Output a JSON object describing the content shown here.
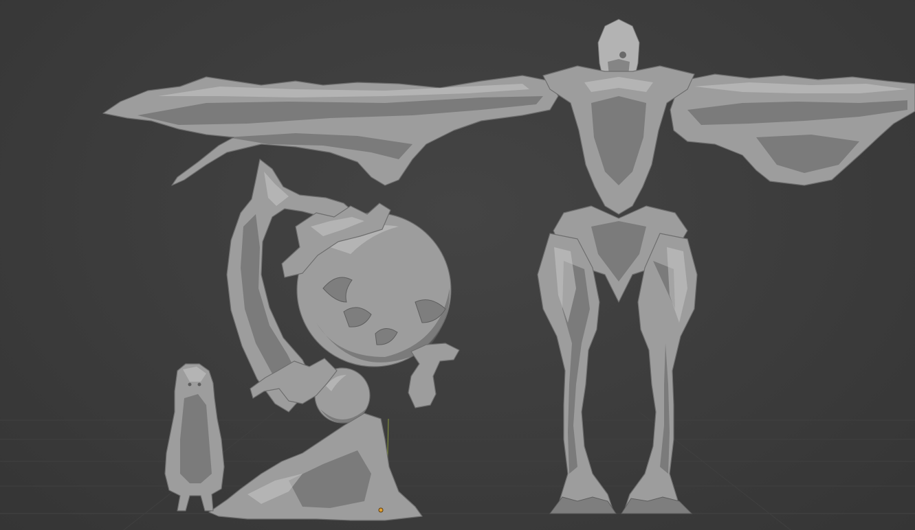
{
  "scene": {
    "background_color": "#3b3b3b",
    "mesh_color": "#9d9d9d",
    "objects": [
      {
        "name": "small-hooded-figure",
        "shading": "solid"
      },
      {
        "name": "orb-scepter-sculpture",
        "shading": "solid"
      },
      {
        "name": "winged-skeletal-creature",
        "shading": "solid"
      }
    ]
  }
}
